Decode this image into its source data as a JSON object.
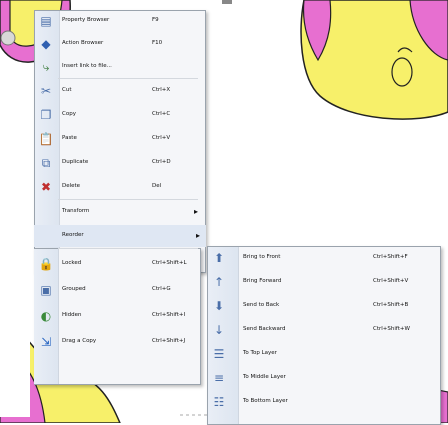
{
  "main_menu": {
    "items": [
      {
        "label": "Property Browser",
        "shortcut": "F9",
        "icon": "property-browser-icon",
        "arrow": ""
      },
      {
        "label": "Action Browser",
        "shortcut": "F10",
        "icon": "action-browser-icon",
        "arrow": ""
      },
      {
        "label": "Insert link to file...",
        "shortcut": "",
        "icon": "insert-link-icon",
        "arrow": ""
      },
      {
        "label": "Cut",
        "shortcut": "Ctrl+X",
        "icon": "cut-icon",
        "arrow": ""
      },
      {
        "label": "Copy",
        "shortcut": "Ctrl+C",
        "icon": "copy-icon",
        "arrow": ""
      },
      {
        "label": "Paste",
        "shortcut": "Ctrl+V",
        "icon": "paste-icon",
        "arrow": ""
      },
      {
        "label": "Duplicate",
        "shortcut": "Ctrl+D",
        "icon": "duplicate-icon",
        "arrow": ""
      },
      {
        "label": "Delete",
        "shortcut": "Del",
        "icon": "delete-icon",
        "arrow": ""
      },
      {
        "label": "Transform",
        "shortcut": "",
        "icon": "",
        "arrow": "▸"
      },
      {
        "label": "Reorder",
        "shortcut": "",
        "icon": "",
        "arrow": "▸"
      },
      {
        "label": "Locked",
        "shortcut": "Ctrl+Shift+L",
        "icon": "lock-icon",
        "arrow": ""
      },
      {
        "label": "Grouped",
        "shortcut": "Ctrl+G",
        "icon": "group-icon",
        "arrow": ""
      },
      {
        "label": "Hidden",
        "shortcut": "Ctrl+Shift+I",
        "icon": "hidden-icon",
        "arrow": ""
      },
      {
        "label": "Drag a Copy",
        "shortcut": "Ctrl+Shift+J",
        "icon": "drag-copy-icon",
        "arrow": ""
      }
    ]
  },
  "submenu": {
    "items": [
      {
        "label": "Bring to Front",
        "shortcut": "Ctrl+Shift+F",
        "icon": "bring-to-front-icon"
      },
      {
        "label": "Bring Forward",
        "shortcut": "Ctrl+Shift+V",
        "icon": "bring-forward-icon"
      },
      {
        "label": "Send to Back",
        "shortcut": "Ctrl+Shift+B",
        "icon": "send-to-back-icon"
      },
      {
        "label": "Send Backward",
        "shortcut": "Ctrl+Shift+W",
        "icon": "send-backward-icon"
      },
      {
        "label": "To Top Layer",
        "shortcut": "",
        "icon": "top-layer-icon"
      },
      {
        "label": "To Middle Layer",
        "shortcut": "",
        "icon": "middle-layer-icon"
      },
      {
        "label": "To Bottom Layer",
        "shortcut": "",
        "icon": "bottom-layer-icon"
      }
    ]
  },
  "colors": {
    "canvas_yellow": "#f7f06a",
    "figure_pink": "#e76fd0",
    "menu_bg": "#f5f6f9",
    "gutter": "#e4eaf3",
    "highlight": "#dfe7f3"
  }
}
